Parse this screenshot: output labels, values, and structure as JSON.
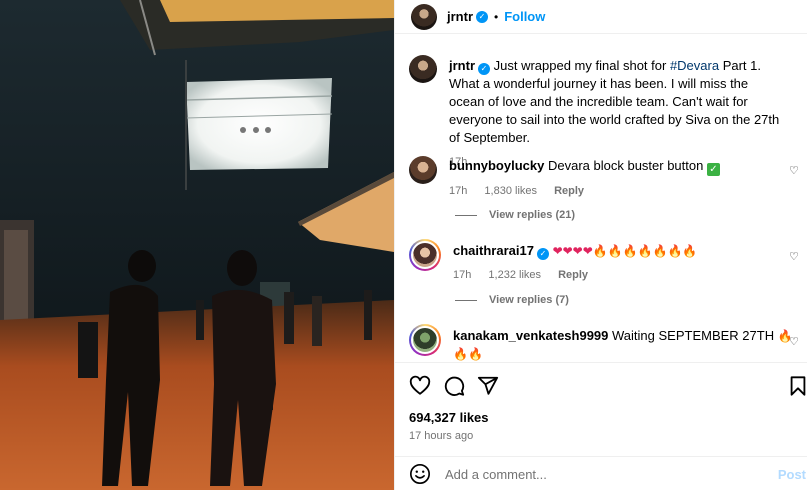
{
  "post": {
    "username": "jrntr",
    "follow_label": "Follow",
    "dot": "•"
  },
  "caption": {
    "username": "jrntr",
    "text_before": "Just wrapped my final shot for ",
    "hashtag": "#Devara",
    "text_after": " Part 1. What a wonderful journey it has been. I will miss the ocean of love and the incredible team. Can't wait for everyone to sail into the world crafted by Siva on the 27th of September.",
    "time": "17h"
  },
  "comments": [
    {
      "username": "bunnyboylucky",
      "text": "Devara block buster button",
      "emoji": "✓",
      "time": "17h",
      "likes": "1,830 likes",
      "reply_label": "Reply",
      "view_replies": "View replies (21)"
    },
    {
      "username": "chaithrarai17",
      "text": "",
      "emoji": "❤❤❤❤🔥🔥🔥🔥🔥🔥🔥",
      "time": "17h",
      "likes": "1,232 likes",
      "reply_label": "Reply",
      "view_replies": "View replies (7)"
    },
    {
      "username": "kanakam_venkatesh9999",
      "text": "Waiting SEPTEMBER 27TH",
      "emoji": "🔥🔥🔥",
      "emoji_line2": "😡😡😡💚💚💚"
    }
  ],
  "actions": {
    "likes": "694,327 likes",
    "time": "17 hours ago",
    "comment_placeholder": "Add a comment...",
    "post_label": "Post"
  },
  "icons": {
    "verified": "✓",
    "more": "•••",
    "heart_small": "♡"
  },
  "colors": {
    "accent": "#0095f6",
    "hashtag": "#00376b",
    "muted": "#737373"
  }
}
